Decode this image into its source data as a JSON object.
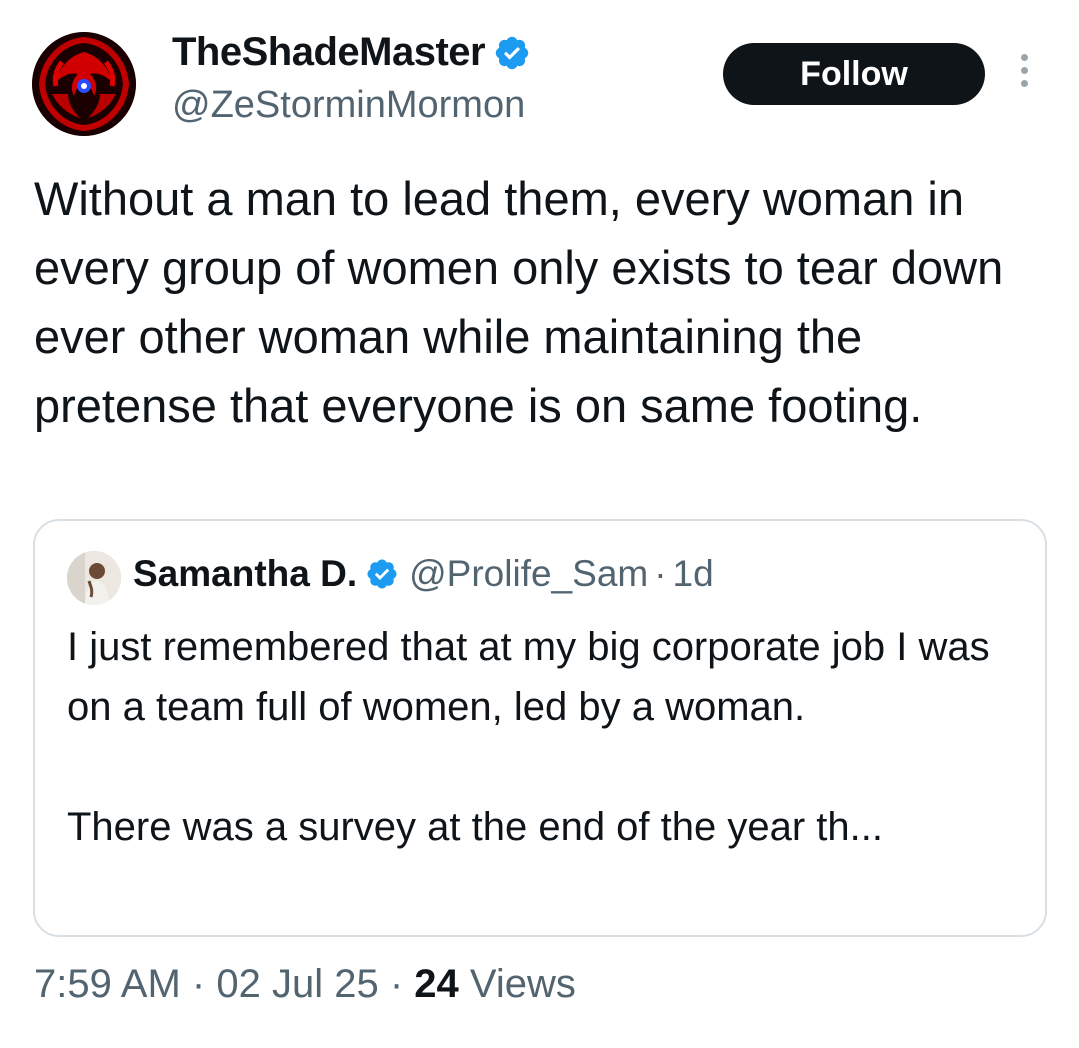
{
  "author": {
    "display_name": "TheShadeMaster",
    "handle": "@ZeStorminMormon",
    "verified_icon": "verified-badge-icon",
    "avatar_icon": "red-ornamental-emblem"
  },
  "follow_button": {
    "label": "Follow"
  },
  "more_menu": {
    "icon": "more-vertical-icon"
  },
  "tweet": {
    "text": "Without a man to lead them, every woman in every group of women only exists to tear down ever other woman while maintaining the pretense that everyone is on same footing."
  },
  "quoted_tweet": {
    "display_name": "Samantha D.",
    "handle": "@Prolife_Sam",
    "separator": "·",
    "time": "1d",
    "text": "I just remembered that at my big corporate job I was on a team full of women, led by a woman.\n\nThere was a survey at the end of the year th..."
  },
  "meta": {
    "time": "7:59 AM",
    "sep1": "·",
    "date": "02 Jul 25",
    "sep2": "·",
    "views_count": "24",
    "views_label": "Views"
  },
  "colors": {
    "text_primary": "#0f1419",
    "text_secondary": "#536471",
    "verified_blue": "#1d9bf0",
    "follow_bg": "#0f1419",
    "border": "#d9e0e5"
  }
}
